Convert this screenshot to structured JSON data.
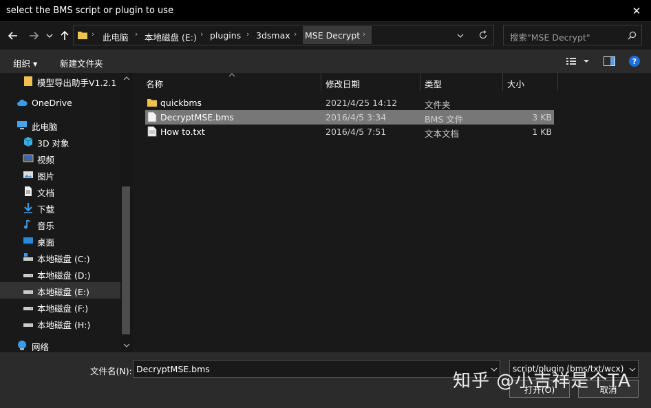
{
  "window": {
    "title": "select the BMS script or plugin to use",
    "close_glyph": "✕"
  },
  "nav": {
    "breadcrumbs": [
      "此电脑",
      "本地磁盘 (E:)",
      "plugins",
      "3dsmax",
      "MSE Decrypt"
    ],
    "search_placeholder": "搜索\"MSE Decrypt\""
  },
  "toolbar": {
    "organize_label": "组织 ▾",
    "new_folder_label": "新建文件夹"
  },
  "sidebar": {
    "items": [
      {
        "label": "模型导出助手V1.2.1",
        "icon": "folder-icon"
      },
      {
        "label": "OneDrive",
        "icon": "cloud-icon"
      },
      {
        "label": "此电脑",
        "icon": "computer-icon"
      },
      {
        "label": "3D 对象",
        "icon": "cube-icon"
      },
      {
        "label": "视频",
        "icon": "video-icon"
      },
      {
        "label": "图片",
        "icon": "picture-icon"
      },
      {
        "label": "文档",
        "icon": "document-icon"
      },
      {
        "label": "下载",
        "icon": "download-icon"
      },
      {
        "label": "音乐",
        "icon": "music-icon"
      },
      {
        "label": "桌面",
        "icon": "desktop-icon"
      },
      {
        "label": "本地磁盘 (C:)",
        "icon": "drive-icon"
      },
      {
        "label": "本地磁盘 (D:)",
        "icon": "drive-icon"
      },
      {
        "label": "本地磁盘 (E:)",
        "icon": "drive-icon"
      },
      {
        "label": "本地磁盘 (F:)",
        "icon": "drive-icon"
      },
      {
        "label": "本地磁盘 (H:)",
        "icon": "drive-icon"
      },
      {
        "label": "网络",
        "icon": "network-icon"
      }
    ]
  },
  "filelist": {
    "columns": [
      "名称",
      "修改日期",
      "类型",
      "大小"
    ],
    "rows": [
      {
        "name": "quickbms",
        "date": "2021/4/25 14:12",
        "type": "文件夹",
        "size": "",
        "icon": "folder-icon"
      },
      {
        "name": "DecryptMSE.bms",
        "date": "2016/4/5 3:34",
        "type": "BMS 文件",
        "size": "3 KB",
        "icon": "file-icon"
      },
      {
        "name": "How to.txt",
        "date": "2016/4/5 7:51",
        "type": "文本文档",
        "size": "1 KB",
        "icon": "text-file-icon"
      }
    ]
  },
  "bottom": {
    "filename_label": "文件名(N):",
    "filename_value": "DecryptMSE.bms",
    "filter_value": "script/plugin (bms/txt/wcx)",
    "open_label": "打开(O)",
    "cancel_label": "取消"
  },
  "watermark": "知乎 @小吉祥是个TA",
  "colors": {
    "background": "#191919",
    "toolbar": "#2b2b2b",
    "selection": "#777777",
    "folder": "#f0c24b",
    "help": "#1e6fd9"
  }
}
